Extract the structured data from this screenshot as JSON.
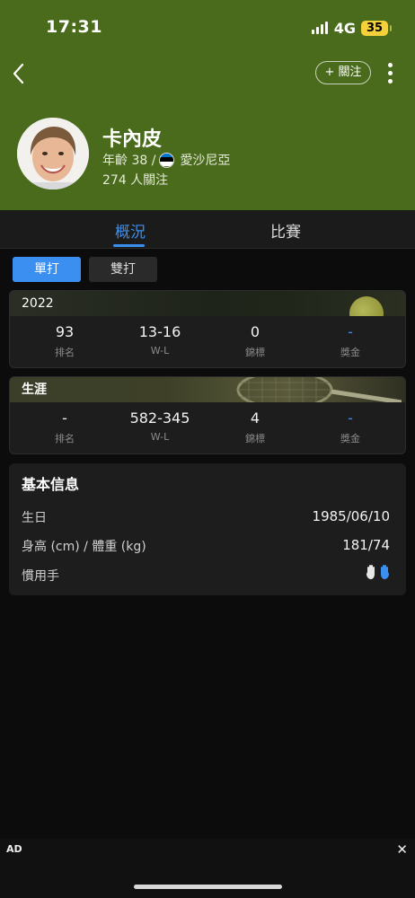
{
  "status_bar": {
    "time": "17:31",
    "network": "4G",
    "battery": "35",
    "battery_color": "#f4d13a"
  },
  "header": {
    "background_color": "#4a6b1b",
    "follow_label": "+ 關注",
    "back_icon": "chevron-left-icon",
    "more_icon": "more-vertical-icon"
  },
  "player": {
    "name": "卡內皮",
    "age_text": "年齡 38 /",
    "country": "愛沙尼亞",
    "flag_colors": [
      "#0072ce",
      "#000000",
      "#ffffff"
    ],
    "followers": "274 人關注"
  },
  "tabs": [
    {
      "label": "概況",
      "active": true
    },
    {
      "label": "比賽",
      "active": false
    }
  ],
  "accent_color": "#3a8ff0",
  "segments": [
    {
      "label": "單打",
      "active": true
    },
    {
      "label": "雙打",
      "active": false
    }
  ],
  "stats": {
    "year": {
      "title": "2022",
      "items": [
        {
          "value": "93",
          "label": "排名"
        },
        {
          "value": "13-16",
          "label": "W-L"
        },
        {
          "value": "0",
          "label": "錦標"
        },
        {
          "value": "-",
          "label": "獎金"
        }
      ]
    },
    "career": {
      "title": "生涯",
      "items": [
        {
          "value": "-",
          "label": "排名"
        },
        {
          "value": "582-345",
          "label": "W-L"
        },
        {
          "value": "4",
          "label": "錦標"
        },
        {
          "value": "-",
          "label": "獎金"
        }
      ]
    }
  },
  "basic_info": {
    "title": "基本信息",
    "rows": [
      {
        "key": "生日",
        "value": "1985/06/10"
      },
      {
        "key": "身高 (cm) / 體重 (kg)",
        "value": "181/74"
      },
      {
        "key": "慣用手",
        "value_icon": "hands-icon"
      }
    ]
  },
  "ad": {
    "label": "AD",
    "close": "✕"
  }
}
